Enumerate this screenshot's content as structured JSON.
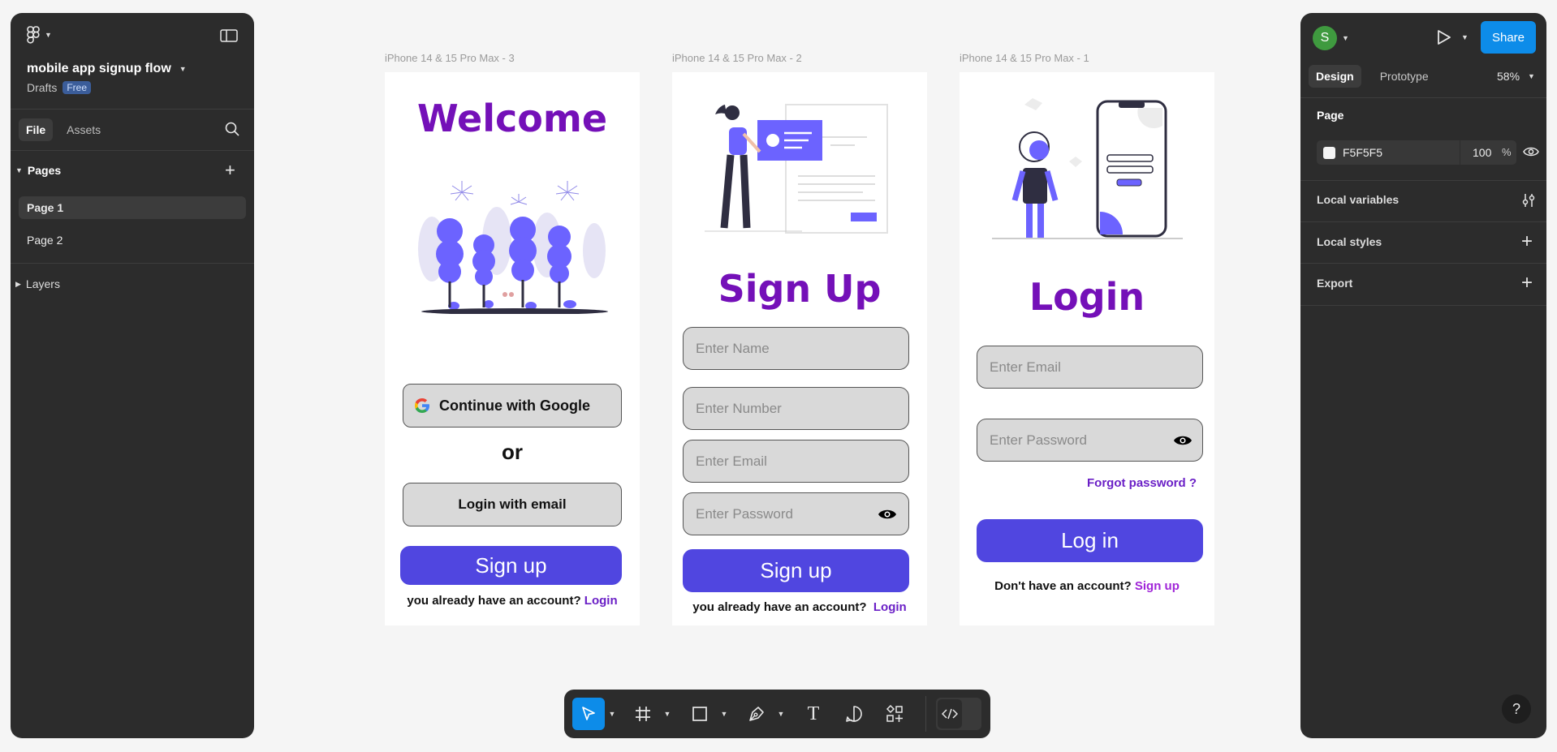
{
  "left_panel": {
    "file_name": "mobile app signup flow",
    "project": "Drafts",
    "plan_badge": "Free",
    "tabs": [
      "File",
      "Assets"
    ],
    "pages_header": "Pages",
    "pages": [
      "Page 1",
      "Page 2"
    ],
    "layers_header": "Layers"
  },
  "right_panel": {
    "avatar_letter": "S",
    "share_label": "Share",
    "tabs": [
      "Design",
      "Prototype"
    ],
    "zoom": "58%",
    "page_section": "Page",
    "page_color": "F5F5F5",
    "page_opacity": "100",
    "percent_sign": "%",
    "sections": [
      "Local variables",
      "Local styles",
      "Export"
    ]
  },
  "frames": {
    "welcome": {
      "label": "iPhone 14 & 15 Pro Max - 3",
      "title": "Welcome",
      "google_button": "Continue  with Google",
      "or_text": "or",
      "email_button": "Login with email",
      "signup_button": "Sign up",
      "footer_text": "you already have an account?",
      "footer_link": "Login"
    },
    "signup": {
      "label": "iPhone 14 & 15 Pro Max - 2",
      "title": "Sign Up",
      "name_placeholder": "Enter Name",
      "number_placeholder": "Enter Number",
      "email_placeholder": "Enter Email",
      "password_placeholder": "Enter Password",
      "signup_button": "Sign up",
      "footer_text": "you already have an account?",
      "footer_link": "Login"
    },
    "login": {
      "label": "iPhone 14 & 15 Pro Max - 1",
      "title": "Login",
      "email_placeholder": "Enter Email",
      "password_placeholder": "Enter Password",
      "forgot_link": "Forgot password ?",
      "login_button": "Log in",
      "footer_text": "Don't have an account?",
      "footer_link": "Sign up"
    }
  },
  "help_label": "?",
  "colors": {
    "accent_purple": "#5046e0",
    "title_purple": "#7410b8",
    "figma_blue": "#0d8ce9",
    "panel_bg": "#2c2c2c",
    "canvas_bg": "#f5f5f5"
  },
  "icons": [
    "figma-logo-icon",
    "sidebar-toggle-icon",
    "search-icon",
    "plus-icon",
    "play-icon",
    "eye-icon",
    "variables-icon",
    "move-tool-icon",
    "frame-tool-icon",
    "rectangle-tool-icon",
    "pen-tool-icon",
    "text-tool-icon",
    "comment-tool-icon",
    "actions-icon",
    "dev-mode-icon",
    "google-logo-icon",
    "help-icon"
  ]
}
